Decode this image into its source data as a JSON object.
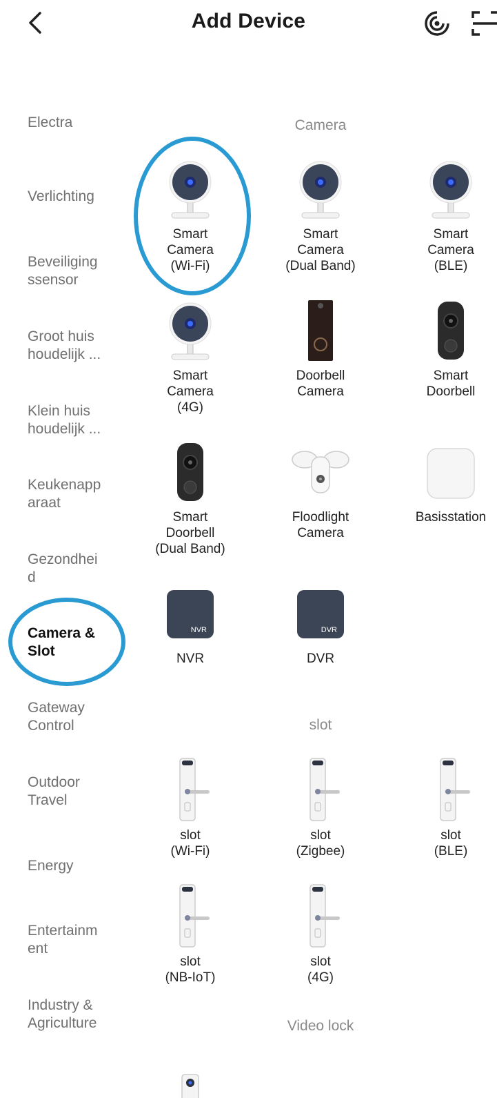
{
  "header": {
    "title": "Add Device"
  },
  "sidebar": {
    "items": [
      {
        "label": "Electra"
      },
      {
        "label": "Verlichting"
      },
      {
        "label": "Beveiliging\nssensor"
      },
      {
        "label": "Groot huis\nhoudelijk ..."
      },
      {
        "label": "Klein huis\nhoudelijk ..."
      },
      {
        "label": "Keukenapp\naraat"
      },
      {
        "label": "Gezondhei\nd"
      },
      {
        "label": "Camera &\nSlot"
      },
      {
        "label": "Gateway\nControl"
      },
      {
        "label": "Outdoor\nTravel"
      },
      {
        "label": "Energy"
      },
      {
        "label": "Entertainm\nent"
      },
      {
        "label": "Industry &\nAgriculture"
      }
    ]
  },
  "sections": {
    "camera": "Camera",
    "slot": "slot",
    "video_lock": "Video lock"
  },
  "devices": {
    "smart_camera_wifi": "Smart\nCamera\n(Wi-Fi)",
    "smart_camera_dual": "Smart\nCamera\n(Dual Band)",
    "smart_camera_ble": "Smart\nCamera\n(BLE)",
    "smart_camera_4g": "Smart\nCamera\n(4G)",
    "doorbell_camera": "Doorbell\nCamera",
    "smart_doorbell": "Smart\nDoorbell",
    "smart_doorbell_dual": "Smart\nDoorbell\n(Dual Band)",
    "floodlight_camera": "Floodlight\nCamera",
    "basisstation": "Basisstation",
    "nvr": "NVR",
    "dvr": "DVR",
    "slot_wifi": "slot\n(Wi-Fi)",
    "slot_zigbee": "slot\n(Zigbee)",
    "slot_ble": "slot\n(BLE)",
    "slot_nbiot": "slot\n(NB-IoT)",
    "slot_4g": "slot\n(4G)"
  },
  "icon_text": {
    "nvr": "NVR",
    "dvr": "DVR"
  },
  "colors": {
    "annotation": "#2a9bd2",
    "active_text": "#111111",
    "inactive_text": "#707070"
  }
}
